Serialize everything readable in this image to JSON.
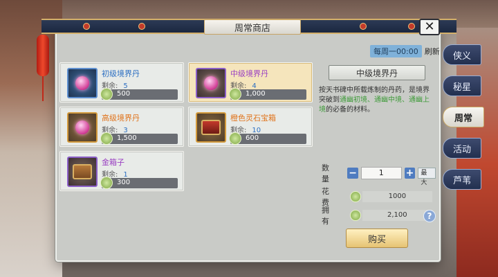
{
  "window": {
    "title": "周常商店"
  },
  "refresh": {
    "timer": "每周一00:00",
    "label": "刷新"
  },
  "side_tabs": [
    {
      "label": "侠义",
      "active": false
    },
    {
      "label": "秘星",
      "active": false
    },
    {
      "label": "周常",
      "active": true
    },
    {
      "label": "活动",
      "active": false
    },
    {
      "label": "芦苇",
      "active": false
    }
  ],
  "items": [
    {
      "name": "初级境界丹",
      "remain_label": "剩余:",
      "remain": "5",
      "price": "500",
      "icon": "orb-icon",
      "rarity": "blue"
    },
    {
      "name": "中级境界丹",
      "remain_label": "剩余:",
      "remain": "4",
      "price": "1,000",
      "icon": "orb-icon",
      "rarity": "purple",
      "selected": true
    },
    {
      "name": "高级境界丹",
      "remain_label": "剩余:",
      "remain": "3",
      "price": "1,500",
      "icon": "orb-icon",
      "rarity": "orange"
    },
    {
      "name": "橙色灵石宝箱",
      "remain_label": "剩余:",
      "remain": "10",
      "price": "600",
      "icon": "chest-icon",
      "rarity": "orange"
    },
    {
      "name": "金箱子",
      "remain_label": "剩余:",
      "remain": "1",
      "price": "300",
      "icon": "chest-icon",
      "rarity": "purple"
    }
  ],
  "detail": {
    "title": "中级境界丹",
    "desc_1": "按天书碑中所载炼制的丹药，是境界突破到",
    "desc_hl": "通幽初境、通幽中境、通幽上境",
    "desc_2": "的必备的材料。",
    "qty_label": "数量",
    "qty_value": "1",
    "max_label": "最大",
    "cost_label": "花费",
    "cost_value": "1000",
    "own_label": "拥有",
    "own_value": "2,100",
    "buy_label": "购买"
  },
  "colors": {
    "orange": "#e0741d",
    "purple": "#9a40c2",
    "accent": "#4f7cc0"
  }
}
